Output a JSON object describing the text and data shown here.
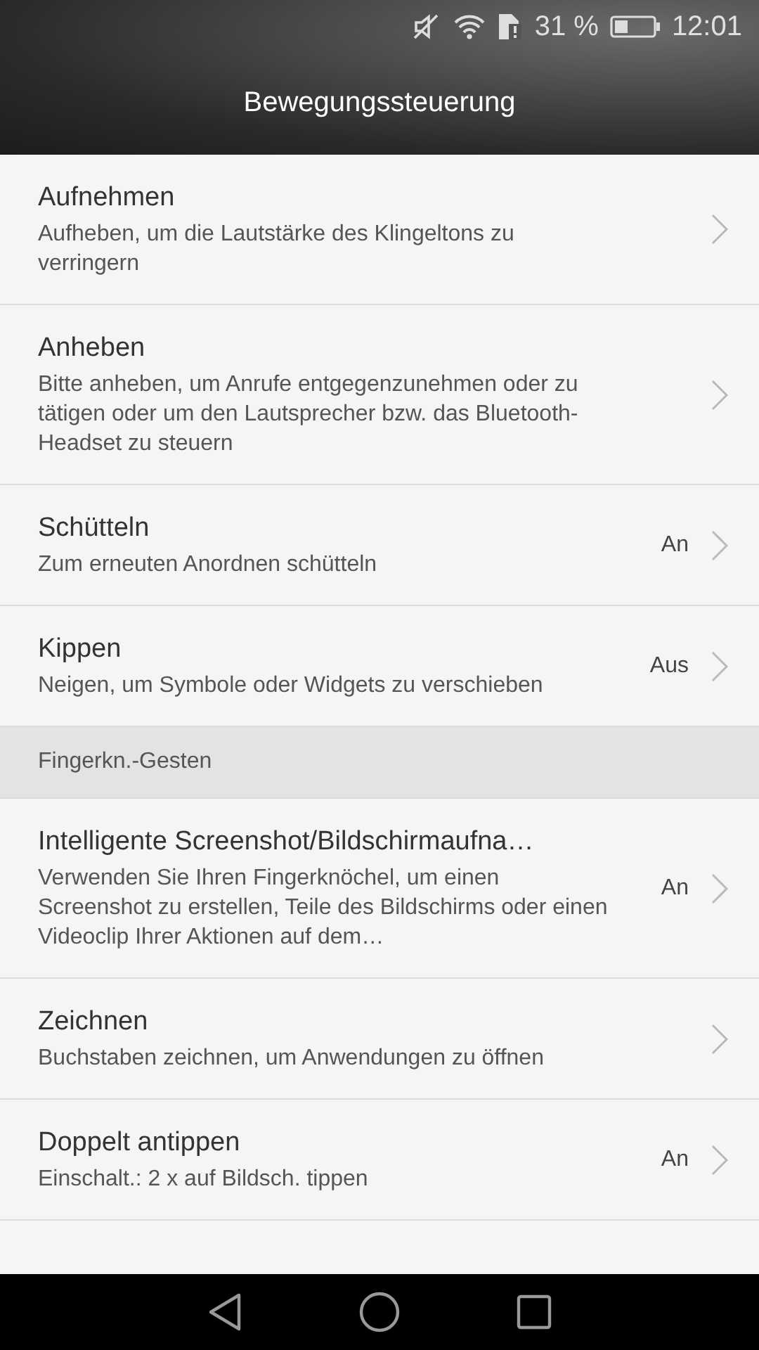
{
  "status_bar": {
    "battery_percent": "31 %",
    "time": "12:01"
  },
  "header": {
    "title": "Bewegungssteuerung"
  },
  "items": [
    {
      "kind": "setting",
      "title": "Aufnehmen",
      "subtitle": "Aufheben, um die Lautstärke des Klingeltons zu verringern"
    },
    {
      "kind": "setting",
      "title": "Anheben",
      "subtitle": "Bitte anheben, um Anrufe entgegenzunehmen oder zu tätigen oder um den Lautsprecher bzw. das Bluetooth-Headset zu steuern"
    },
    {
      "kind": "setting",
      "title": "Schütteln",
      "subtitle": "Zum erneuten Anordnen schütteln",
      "value": "An"
    },
    {
      "kind": "setting",
      "title": "Kippen",
      "subtitle": "Neigen, um Symbole oder Widgets zu verschieben",
      "value": "Aus"
    },
    {
      "kind": "section",
      "title": "Fingerkn.-Gesten"
    },
    {
      "kind": "setting",
      "title": "Intelligente Screenshot/Bildschirmaufna…",
      "subtitle": "Verwenden Sie Ihren Fingerknöchel, um einen Screenshot zu erstellen, Teile des Bildschirms oder einen Videoclip Ihrer Aktionen auf dem…",
      "value": "An"
    },
    {
      "kind": "setting",
      "title": "Zeichnen",
      "subtitle": "Buchstaben zeichnen, um Anwendungen zu öffnen"
    },
    {
      "kind": "setting",
      "title": "Doppelt antippen",
      "subtitle": "Einschalt.: 2 x auf Bildsch. tippen",
      "value": "An"
    }
  ]
}
